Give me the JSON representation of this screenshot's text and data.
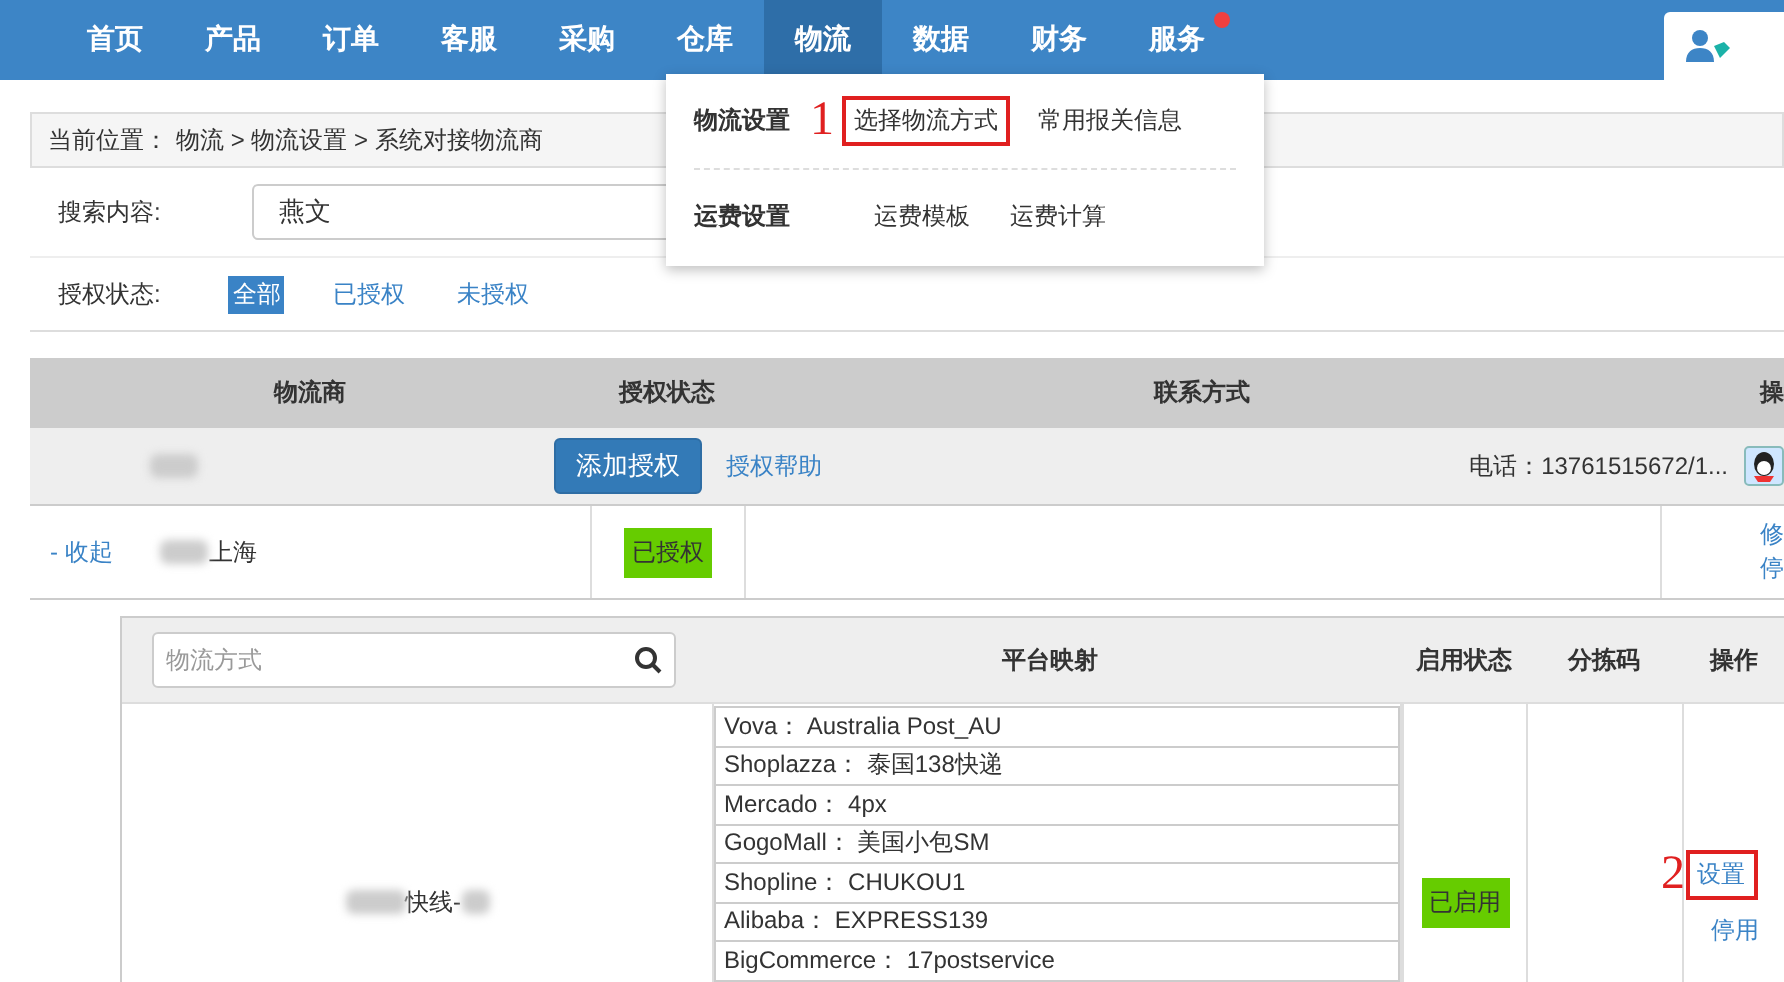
{
  "nav": {
    "items": [
      {
        "label": "首页",
        "selected": false,
        "dot": false
      },
      {
        "label": "产品",
        "selected": false,
        "dot": false
      },
      {
        "label": "订单",
        "selected": false,
        "dot": false
      },
      {
        "label": "客服",
        "selected": false,
        "dot": false
      },
      {
        "label": "采购",
        "selected": false,
        "dot": false
      },
      {
        "label": "仓库",
        "selected": false,
        "dot": false
      },
      {
        "label": "物流",
        "selected": true,
        "dot": false
      },
      {
        "label": "数据",
        "selected": false,
        "dot": false
      },
      {
        "label": "财务",
        "selected": false,
        "dot": false
      },
      {
        "label": "服务",
        "selected": false,
        "dot": true
      }
    ]
  },
  "dropdown": {
    "groups": [
      {
        "title": "物流设置",
        "links": [
          {
            "label": "选择物流方式",
            "callout": "1"
          },
          {
            "label": "常用报关信息"
          }
        ]
      },
      {
        "title": "运费设置",
        "links": [
          {
            "label": "运费模板"
          },
          {
            "label": "运费计算"
          }
        ]
      }
    ]
  },
  "breadcrumb": {
    "label": "当前位置：",
    "path": "物流 > 物流设置 > 系统对接物流商"
  },
  "search": {
    "label": "搜索内容:",
    "value": "燕文"
  },
  "auth_filter": {
    "label": "授权状态:",
    "options": [
      {
        "label": "全部",
        "selected": true
      },
      {
        "label": "已授权",
        "selected": false
      },
      {
        "label": "未授权",
        "selected": false
      }
    ]
  },
  "table": {
    "columns": [
      "物流商",
      "授权状态",
      "联系方式",
      "操"
    ],
    "toolbar": {
      "add_button": "添加授权",
      "help_link": "授权帮助",
      "phone": "电话：13761515672/1..."
    },
    "row": {
      "toggle": "- 收起",
      "name": "上海",
      "status": "已授权",
      "actions": [
        "修",
        "停"
      ]
    }
  },
  "subtable": {
    "search_placeholder": "物流方式",
    "columns": [
      "平台映射",
      "启用状态",
      "分拣码",
      "操作"
    ],
    "row": {
      "name": "快线-",
      "mappings": [
        "Vova： Australia Post_AU",
        "Shoplazza： 泰国138快递",
        "Mercado： 4px",
        "GogoMall： 美国小包SM",
        "Shopline： CHUKOU1",
        "Alibaba： EXPRESS139",
        "BigCommerce： 17postservice"
      ],
      "status": "已启用",
      "actions": [
        {
          "label": "设置",
          "callout": "2"
        },
        {
          "label": "停用"
        }
      ]
    }
  }
}
